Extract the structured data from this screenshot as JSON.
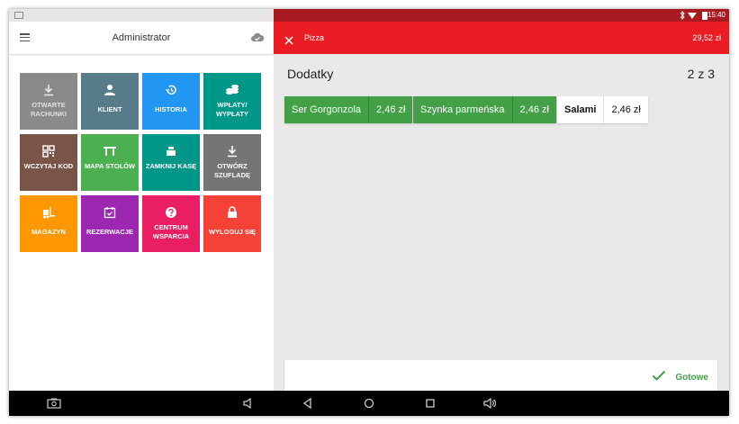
{
  "status_bar": {
    "time": "15:40"
  },
  "left_panel": {
    "title": "Administrator",
    "tiles": [
      {
        "label": "OTWARTE RACHUNKI",
        "icon": "download-icon",
        "color": "#8a8a8a"
      },
      {
        "label": "KLIENT",
        "icon": "person-icon",
        "color": "#577b89"
      },
      {
        "label": "HISTORIA",
        "icon": "history-icon",
        "color": "#2196f3"
      },
      {
        "label": "WPŁATY/ WYPŁATY",
        "icon": "coins-icon",
        "color": "#009688"
      },
      {
        "label": "WCZYTAJ KOD",
        "icon": "qr-code-icon",
        "color": "#795548"
      },
      {
        "label": "MAPA STOŁÓW",
        "icon": "table-icon",
        "color": "#4caf50"
      },
      {
        "label": "ZAMKNIJ KASĘ",
        "icon": "register-icon",
        "color": "#009688"
      },
      {
        "label": "OTWÓRZ SZUFLADĘ",
        "icon": "download-icon",
        "color": "#757575"
      },
      {
        "label": "MAGAZYN",
        "icon": "forklift-icon",
        "color": "#ff9800"
      },
      {
        "label": "REZERWACJE",
        "icon": "calendar-check-icon",
        "color": "#9c27b0"
      },
      {
        "label": "CENTRUM WSPARCIA",
        "icon": "help-icon",
        "color": "#e91e63"
      },
      {
        "label": "WYLOGUJ SIĘ",
        "icon": "lock-icon",
        "color": "#f44336"
      }
    ]
  },
  "right_panel": {
    "product": "Pizza",
    "total": "29,52 zł",
    "section_title": "Dodatky",
    "counter": "2 z 3",
    "addons": [
      {
        "name": "Ser Gorgonzola",
        "price": "2,46 zł",
        "selected": true
      },
      {
        "name": "Szynka parmeńska",
        "price": "2,46 zł",
        "selected": true
      },
      {
        "name": "Salami",
        "price": "2,46 zł",
        "selected": false
      }
    ],
    "done_label": "Gotowe"
  },
  "colors": {
    "header_red": "#ec1c24",
    "status_dark_red": "#a81a1f",
    "addon_green": "#43a047",
    "background": "#e9e9e9"
  }
}
